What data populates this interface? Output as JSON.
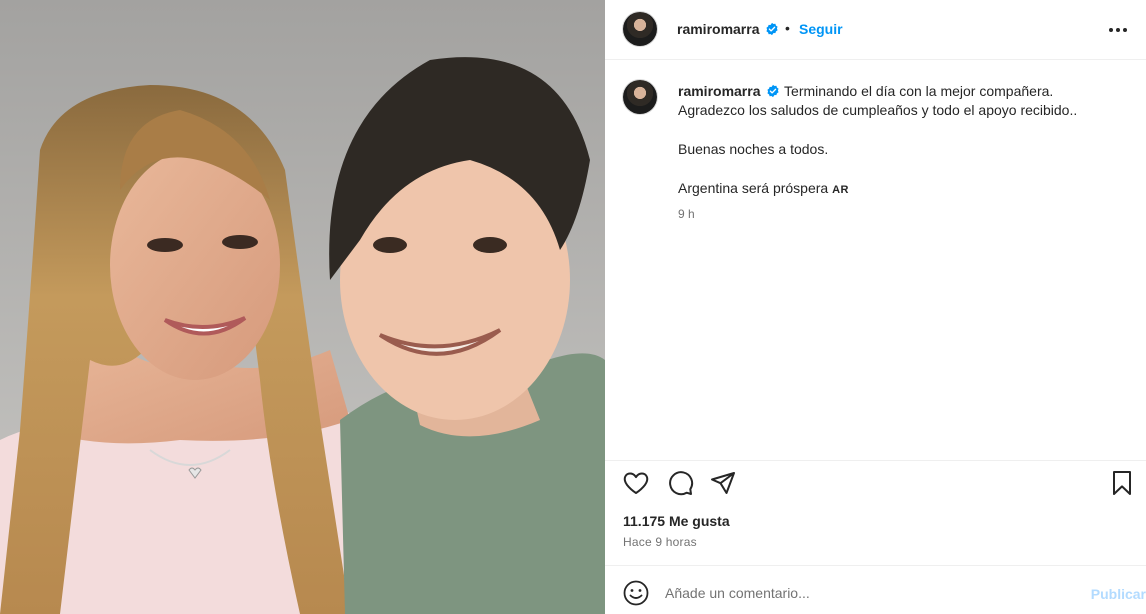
{
  "post": {
    "username": "ramiromarra",
    "follow_label": "Seguir",
    "separator": "•",
    "caption_lines": [
      "Terminando el día con la mejor compañera.",
      "Agradezco los saludos de cumpleaños y todo el apoyo recibido..",
      "Buenas noches a todos.",
      "Argentina será próspera"
    ],
    "flag_text": "AR",
    "caption_time": "9 h",
    "likes": "11.175 Me gusta",
    "time_ago": "Hace 9 horas"
  },
  "comment": {
    "placeholder": "Añade un comentario...",
    "publish_label": "Publicar"
  },
  "icons": {
    "more": "more-options-icon",
    "like": "heart-icon",
    "comment": "comment-icon",
    "share": "share-icon",
    "save": "bookmark-icon",
    "emoji": "emoji-icon",
    "verified": "verified-badge-icon"
  },
  "colors": {
    "accent": "#0095f6",
    "publish_disabled": "#b3dbff",
    "text": "#262626",
    "muted": "#737373",
    "verified": "#0095f6"
  }
}
